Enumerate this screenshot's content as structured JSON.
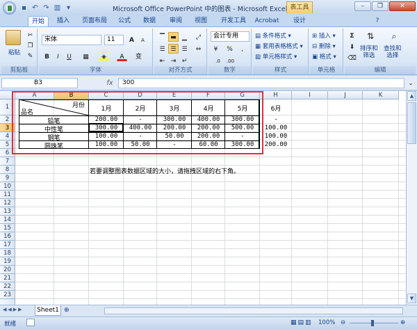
{
  "window": {
    "title": "Microsoft Office PowerPoint 中的图表 - Microsoft Excel",
    "context_tab": "表工具"
  },
  "tabs": [
    "开始",
    "插入",
    "页面布局",
    "公式",
    "数据",
    "审阅",
    "视图",
    "开发工具",
    "Acrobat",
    "设计"
  ],
  "ribbon": {
    "clipboard": {
      "label": "剪贴板",
      "paste": "粘贴"
    },
    "font": {
      "label": "字体",
      "name": "宋体",
      "size": "11",
      "bold": "B",
      "italic": "I",
      "underline": "U",
      "grow": "A",
      "shrink": "A",
      "fontcolor": "A",
      "special": "变"
    },
    "alignment": {
      "label": "对齐方式"
    },
    "number": {
      "label": "数字",
      "format": "会计专用",
      "percent": "%",
      "comma": ","
    },
    "styles": {
      "label": "样式",
      "conditional": "条件格式",
      "table": "套用表格格式",
      "cell": "单元格样式"
    },
    "cells": {
      "label": "单元格",
      "insert": "插入",
      "delete": "删除",
      "format": "格式"
    },
    "editing": {
      "label": "编辑",
      "sum": "Σ",
      "sort": "排序和\n筛选",
      "find": "查找和\n选择"
    }
  },
  "formula_bar": {
    "name_box": "B3",
    "fx": "fx",
    "value": "300"
  },
  "sheet": {
    "columns": [
      "A",
      "B",
      "C",
      "D",
      "E",
      "F",
      "G",
      "H",
      "I",
      "J",
      "K"
    ],
    "rows": [
      "1",
      "2",
      "3",
      "4",
      "5",
      "6",
      "7",
      "8",
      "9",
      "10",
      "11",
      "12",
      "13",
      "14",
      "15",
      "16",
      "17",
      "18",
      "19",
      "20",
      "21",
      "22",
      "23"
    ],
    "header_top": "月份",
    "header_bottom": "品名",
    "months": [
      "1月",
      "2月",
      "3月",
      "4月",
      "5月",
      "6月"
    ],
    "data": [
      {
        "name": "铅笔",
        "values": [
          "200.00",
          "-",
          "300.00",
          "400.00",
          "300.00",
          "-"
        ]
      },
      {
        "name": "中性笔",
        "values": [
          "300.00",
          "400.00",
          "200.00",
          "200.00",
          "500.00",
          "100.00"
        ]
      },
      {
        "name": "钢笔",
        "values": [
          "100.00",
          "-",
          "50.00",
          "200.00",
          "-",
          "100.00"
        ]
      },
      {
        "name": "圆珠笔",
        "values": [
          "100.00",
          "50.00",
          "-",
          "60.00",
          "300.00",
          "200.00"
        ]
      }
    ],
    "note": "若要调整图表数据区域的大小，请拖拽区域的右下角。"
  },
  "sheet_tab": "Sheet1",
  "status": {
    "mode": "就绪",
    "zoom": "100%"
  }
}
